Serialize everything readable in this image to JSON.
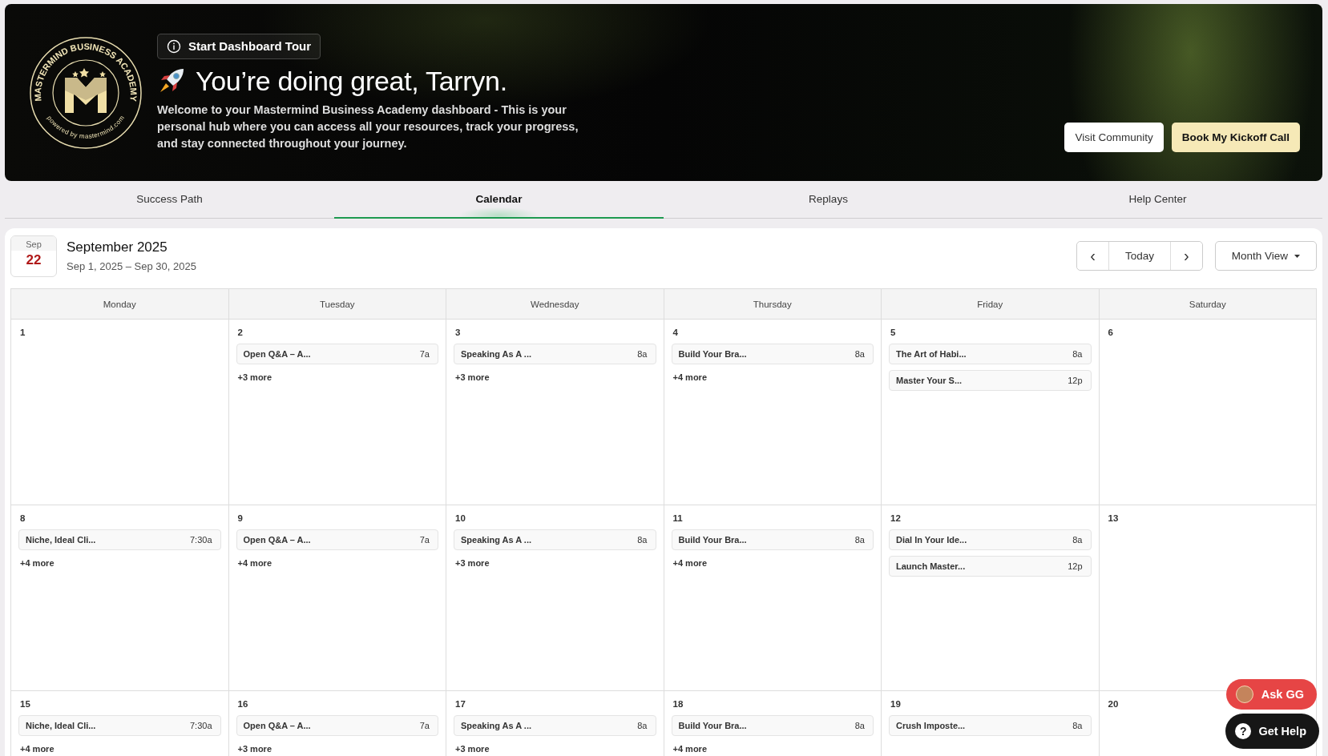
{
  "hero": {
    "logo": {
      "ring_text": "MASTERMIND BUSINESS ACADEMY",
      "powered_text": "powered by mastermind.com"
    },
    "tour_button": "Start Dashboard Tour",
    "title": "You’re doing great, Tarryn.",
    "intro": "Welcome to your Mastermind Business Academy dashboard - This is your personal hub where you can access all your resources, track your progress, and stay connected throughout your journey.",
    "buttons": [
      {
        "label": "Visit Community",
        "kind": "secondary"
      },
      {
        "label": "Book My Kickoff Call",
        "kind": "primary"
      }
    ]
  },
  "tabs": [
    {
      "label": "Success Path",
      "selected": false
    },
    {
      "label": "Calendar",
      "selected": true
    },
    {
      "label": "Replays",
      "selected": false
    },
    {
      "label": "Help Center",
      "selected": false
    }
  ],
  "calendar": {
    "today_badge": {
      "month": "Sep",
      "day": "22"
    },
    "title": "September 2025",
    "range": "Sep 1, 2025 – Sep 30, 2025",
    "nav": {
      "prev": "‹",
      "today": "Today",
      "next": "›"
    },
    "view_button": "Month View",
    "weekdays": [
      "Monday",
      "Tuesday",
      "Wednesday",
      "Thursday",
      "Friday",
      "Saturday"
    ],
    "weeks": [
      [
        {
          "day": "1"
        },
        {
          "day": "2",
          "events": [
            {
              "title": "Open Q&A – A...",
              "time": "7a"
            }
          ],
          "more": "+3 more"
        },
        {
          "day": "3",
          "events": [
            {
              "title": "Speaking As A ...",
              "time": "8a"
            }
          ],
          "more": "+3 more"
        },
        {
          "day": "4",
          "events": [
            {
              "title": "Build Your Bra...",
              "time": "8a"
            }
          ],
          "more": "+4 more"
        },
        {
          "day": "5",
          "events": [
            {
              "title": "The Art of Habi...",
              "time": "8a"
            },
            {
              "title": "Master Your S...",
              "time": "12p"
            }
          ]
        },
        {
          "day": "6"
        }
      ],
      [
        {
          "day": "8",
          "events": [
            {
              "title": "Niche, Ideal Cli...",
              "time": "7:30a"
            }
          ],
          "more": "+4 more"
        },
        {
          "day": "9",
          "events": [
            {
              "title": "Open Q&A – A...",
              "time": "7a"
            }
          ],
          "more": "+4 more"
        },
        {
          "day": "10",
          "events": [
            {
              "title": "Speaking As A ...",
              "time": "8a"
            }
          ],
          "more": "+3 more"
        },
        {
          "day": "11",
          "events": [
            {
              "title": "Build Your Bra...",
              "time": "8a"
            }
          ],
          "more": "+4 more"
        },
        {
          "day": "12",
          "events": [
            {
              "title": "Dial In Your Ide...",
              "time": "8a"
            },
            {
              "title": "Launch Master...",
              "time": "12p"
            }
          ]
        },
        {
          "day": "13"
        }
      ],
      [
        {
          "day": "15",
          "events": [
            {
              "title": "Niche, Ideal Cli...",
              "time": "7:30a"
            }
          ],
          "more": "+4 more"
        },
        {
          "day": "16",
          "events": [
            {
              "title": "Open Q&A – A...",
              "time": "7a"
            }
          ],
          "more": "+3 more"
        },
        {
          "day": "17",
          "events": [
            {
              "title": "Speaking As A ...",
              "time": "8a"
            }
          ],
          "more": "+3 more"
        },
        {
          "day": "18",
          "events": [
            {
              "title": "Build Your Bra...",
              "time": "8a"
            }
          ],
          "more": "+4 more"
        },
        {
          "day": "19",
          "events": [
            {
              "title": "Crush Imposte...",
              "time": "8a"
            }
          ]
        },
        {
          "day": "20"
        }
      ]
    ]
  },
  "floating": {
    "ask_button": "Ask GG",
    "help_button": "Get Help",
    "help_glyph": "?"
  }
}
